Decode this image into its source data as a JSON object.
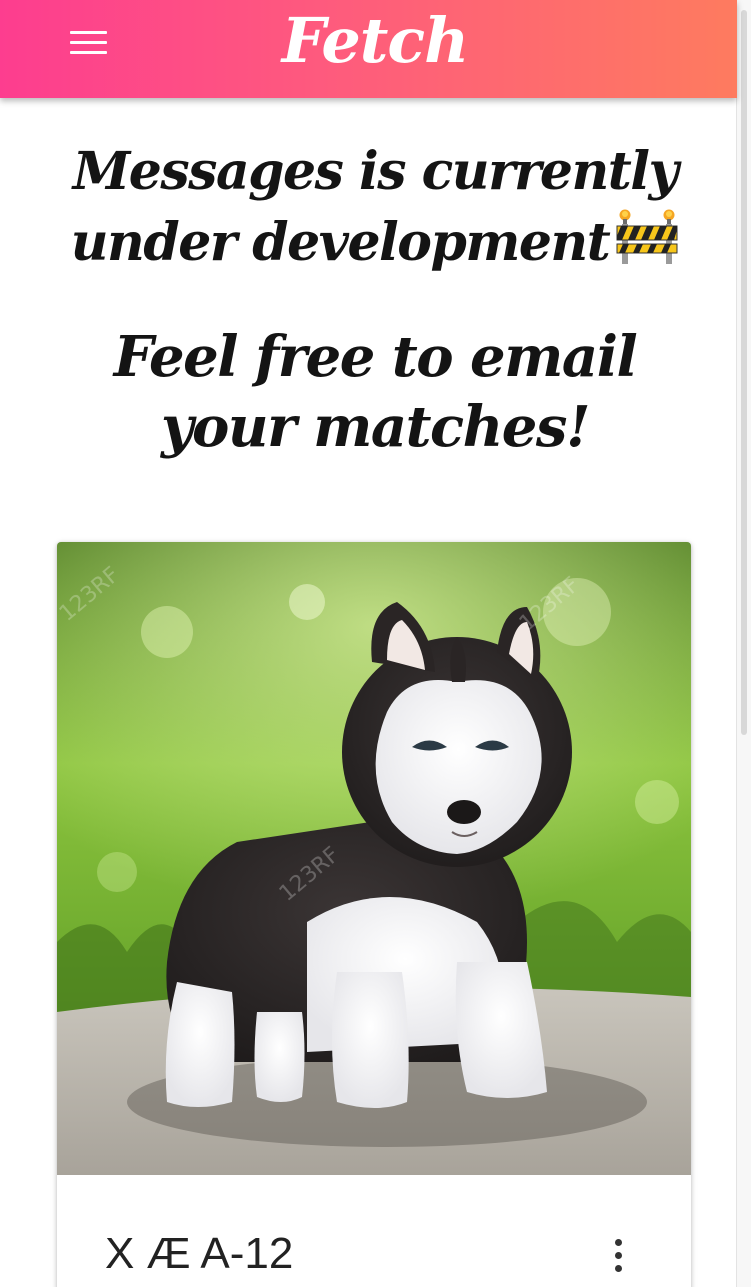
{
  "app": {
    "brand": "Fetch"
  },
  "header": {
    "menu_icon": "hamburger-menu-icon"
  },
  "main": {
    "heading_line1": "Messages is currently under development",
    "heading_icon": "construction-barrier-icon",
    "heading_line2": "Feel free to email your matches!"
  },
  "match_card": {
    "photo_subject": "husky puppy",
    "name": "X Æ A-12",
    "more_icon": "more-vertical-icon"
  },
  "colors": {
    "header_gradient_start": "#fd3d8f",
    "header_gradient_end": "#fe7b5f",
    "text": "#141414"
  }
}
